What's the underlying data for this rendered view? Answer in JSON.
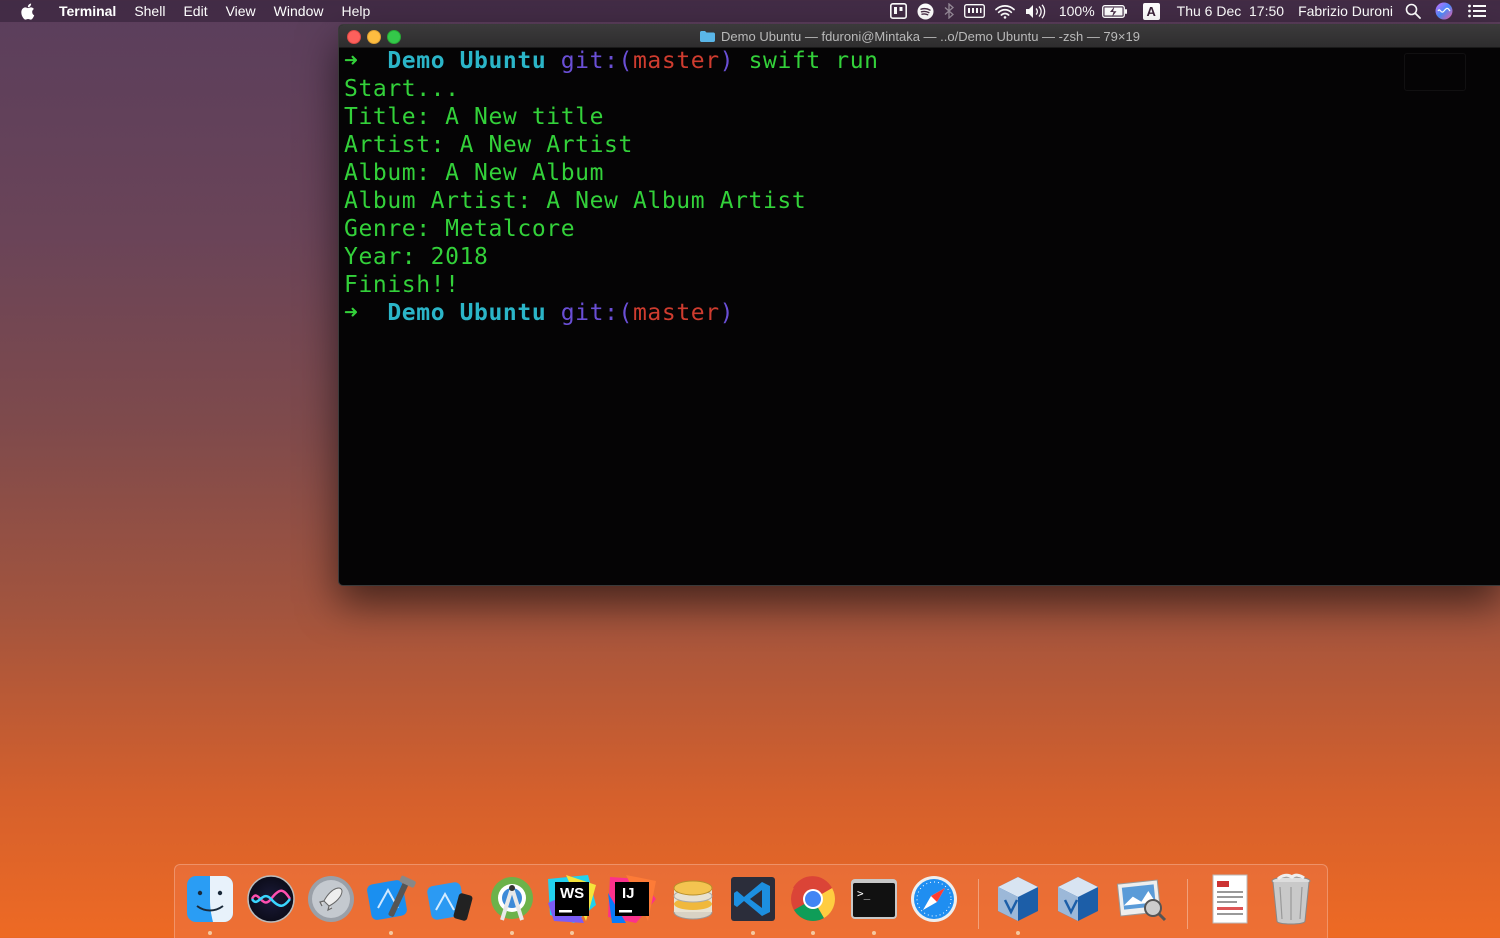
{
  "menubar": {
    "app": "Terminal",
    "items": [
      "Shell",
      "Edit",
      "View",
      "Window",
      "Help"
    ],
    "battery": "100%",
    "input_source": "A",
    "clock": "Thu 6 Dec  17:50",
    "user": "Fabrizio Duroni"
  },
  "window": {
    "title": "Demo Ubuntu — fduroni@Mintaka — ..o/Demo Ubuntu — -zsh — 79×19"
  },
  "terminal": {
    "prompt_arrow": "➜",
    "prompt_dir": "Demo Ubuntu",
    "prompt_git": "git:(",
    "prompt_branch": "master",
    "prompt_git_close": ")",
    "command": "swift run",
    "output": [
      "Start...",
      "Title: A New title",
      "Artist: A New Artist",
      "Album: A New Album",
      "Album Artist: A New Album Artist",
      "Genre: Metalcore",
      "Year: 2018",
      "Finish!!"
    ]
  },
  "dock": {
    "apps": [
      "finder-icon",
      "siri-icon",
      "launchpad-icon",
      "xcode-icon",
      "simulator-icon",
      "android-studio-icon",
      "webstorm-icon",
      "intellij-icon",
      "sequel-pro-icon",
      "vscode-icon",
      "chrome-icon",
      "terminal-icon",
      "safari-icon",
      "virtualbox-icon",
      "virtualbox-vm-icon",
      "preview-icon",
      "document-icon",
      "trash-icon"
    ],
    "ws_label": "WS",
    "ij_label": "IJ",
    "term_label": ">_"
  }
}
